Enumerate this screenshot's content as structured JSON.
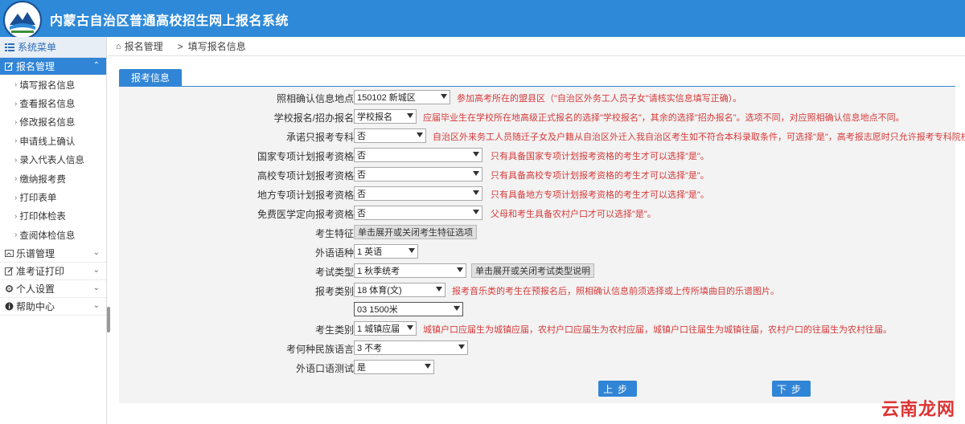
{
  "header": {
    "title": "内蒙古自治区普通高校招生网上报名系统"
  },
  "sidebar": {
    "title": "系统菜单",
    "groups": [
      {
        "label": "报名管理",
        "expanded": true,
        "items": [
          "填写报名信息",
          "查看报名信息",
          "修改报名信息",
          "申请线上确认",
          "录入代表人信息",
          "缴纳报考费",
          "打印表单",
          "打印体检表",
          "查阅体检信息"
        ]
      },
      {
        "label": "乐谱管理"
      },
      {
        "label": "准考证打印"
      },
      {
        "label": "个人设置"
      },
      {
        "label": "帮助中心"
      }
    ]
  },
  "breadcrumb": {
    "home": "报名管理",
    "current": "填写报名信息"
  },
  "tab": {
    "label": "报考信息"
  },
  "form": {
    "rows": [
      {
        "label": "照相确认信息地点",
        "value": "150102 新城区",
        "hint": "参加高考所在的盟县区（\"自治区外务工人员子女\"请核实信息填写正确）。"
      },
      {
        "label": "学校报名/招办报名",
        "value": "学校报名",
        "hint": "应届毕业生在学校所在地高级正式报名的选择\"学校报名\"，其余的选择\"招办报名\"。选项不同，对应照相确认信息地点不同。"
      },
      {
        "label": "承诺只报考专科",
        "value": "否",
        "hint": "自治区外来务工人员随迁子女及户籍从自治区外迁入我自治区考生如不符合本科录取条件，可选择\"是\"，高考报志愿时只允许报考专科院校。"
      },
      {
        "label": "国家专项计划报考资格",
        "value": "否",
        "hint": "只有具备国家专项计划报考资格的考生才可以选择\"是\"。"
      },
      {
        "label": "高校专项计划报考资格",
        "value": "否",
        "hint": "只有具备高校专项计划报考资格的考生才可以选择\"是\"。"
      },
      {
        "label": "地方专项计划报考资格",
        "value": "否",
        "hint": "只有具备地方专项计划报考资格的考生才可以选择\"是\"。"
      },
      {
        "label": "免费医学定向报考资格",
        "value": "否",
        "hint": "父母和考生具备农村户口才可以选择\"是\"。"
      }
    ],
    "feature_label": "考生特征",
    "feature_button": "单击展开或关闭考生特征选项",
    "language_label": "外语语种",
    "language_value": "1 英语",
    "examtype_label": "考试类型",
    "examtype_value": "1 秋季统考",
    "examtype_button": "单击展开或关闭考试类型说明",
    "category_label": "报考类别",
    "category_value": "18 体育(文)",
    "category_hint": "报考音乐类的考生在预报名后，照相确认信息前须选择或上传所填曲目的乐谱图片。",
    "subcategory_value": "03 1500米",
    "studenttype_label": "考生类别",
    "studenttype_value": "1 城镇应届",
    "studenttype_hint": "城镇户口应届生为城镇应届，农村户口应届生为农村应届，城镇户口往届生为城镇往届，农村户口的往届生为农村往届。",
    "minority_label": "考何种民族语言",
    "minority_value": "3 不考",
    "oral_label": "外语口语测试",
    "oral_value": "是"
  },
  "buttons": {
    "prev": "上步",
    "next": "下步"
  },
  "watermark": "云南龙网",
  "colors": {
    "primary": "#3185d6",
    "header": "#2e8ad8",
    "hint": "#d63a3a"
  }
}
